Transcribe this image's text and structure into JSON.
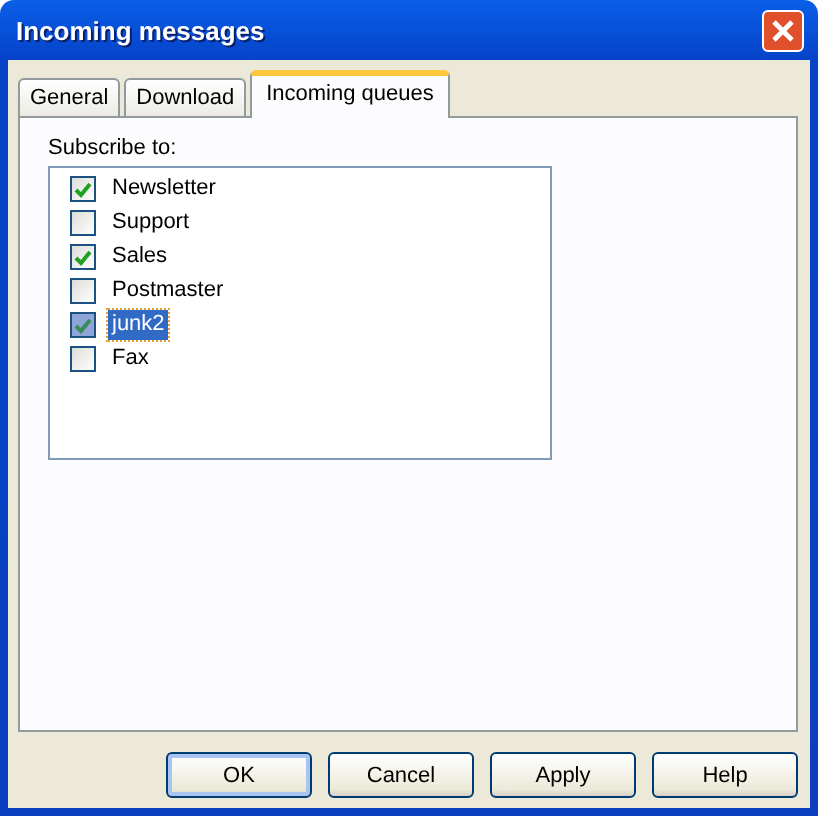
{
  "window": {
    "title": "Incoming messages"
  },
  "tabs": [
    {
      "label": "General",
      "selected": false
    },
    {
      "label": "Download",
      "selected": false
    },
    {
      "label": "Incoming queues",
      "selected": true
    }
  ],
  "subscribe_label": "Subscribe to:",
  "queues": [
    {
      "label": "Newsletter",
      "checked": true,
      "selected": false
    },
    {
      "label": "Support",
      "checked": false,
      "selected": false
    },
    {
      "label": "Sales",
      "checked": true,
      "selected": false
    },
    {
      "label": "Postmaster",
      "checked": false,
      "selected": false
    },
    {
      "label": "junk2",
      "checked": true,
      "selected": true
    },
    {
      "label": "Fax",
      "checked": false,
      "selected": false
    }
  ],
  "buttons": [
    {
      "label": "OK",
      "default": true
    },
    {
      "label": "Cancel",
      "default": false
    },
    {
      "label": "Apply",
      "default": false
    },
    {
      "label": "Help",
      "default": false
    }
  ]
}
